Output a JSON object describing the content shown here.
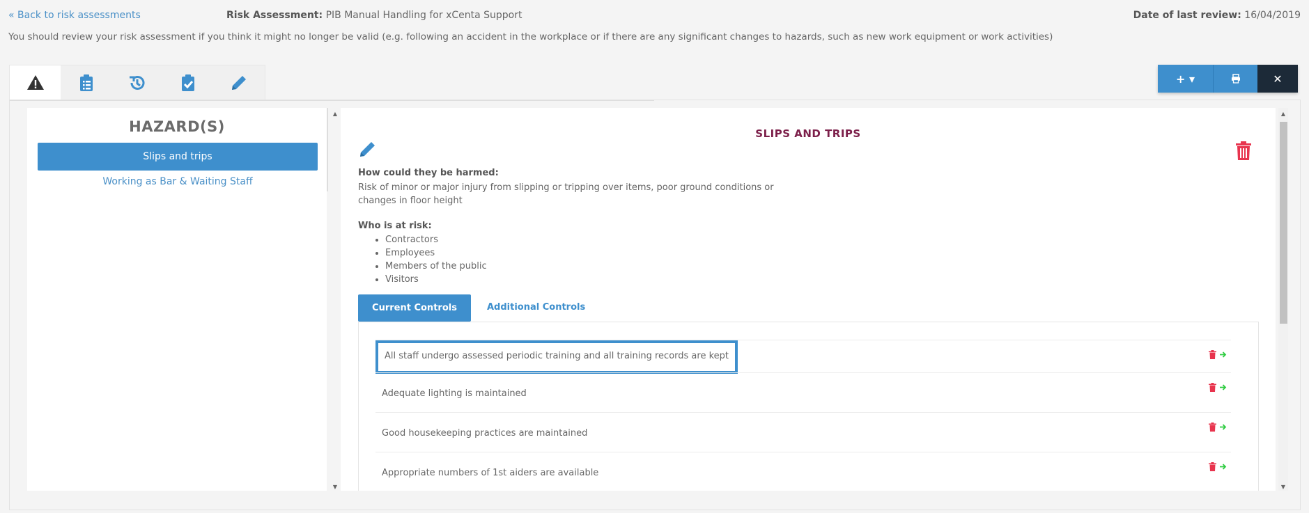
{
  "header": {
    "back_link": "« Back to risk assessments",
    "assessment_label": "Risk Assessment:",
    "assessment_name": "PIB Manual Handling for xCenta Support",
    "review_label": "Date of last review:",
    "review_date": "16/04/2019",
    "notice": "You should review your risk assessment if you think it might no longer be valid (e.g. following an accident in the workplace or if there are any significant changes to hazards, such as new work equipment or work activities)"
  },
  "tabs": [
    {
      "icon": "warning-icon",
      "active": true
    },
    {
      "icon": "clipboard-list-icon",
      "active": false
    },
    {
      "icon": "history-icon",
      "active": false
    },
    {
      "icon": "clipboard-check-icon",
      "active": false
    },
    {
      "icon": "pencil-icon",
      "active": false
    }
  ],
  "actions": {
    "add_label": "+ ▾",
    "print_icon": "print-icon",
    "close_label": "✕"
  },
  "hazards": {
    "title": "HAZARD(S)",
    "items": [
      {
        "label": "Slips and trips",
        "active": true
      },
      {
        "label": "Working as Bar & Waiting Staff",
        "active": false
      }
    ]
  },
  "detail": {
    "title": "SLIPS AND TRIPS",
    "harm_label": "How could they be harmed:",
    "harm_text": "Risk of minor or major injury from slipping or tripping over items, poor ground conditions or changes in floor height",
    "risk_label": "Who is at risk:",
    "at_risk": [
      "Contractors",
      "Employees",
      "Members of the public",
      "Visitors"
    ],
    "control_tabs": {
      "current": "Current Controls",
      "additional": "Additional Controls"
    },
    "controls": [
      "All staff undergo assessed periodic training and all training records are kept",
      "Adequate lighting is maintained",
      "Good housekeeping practices are maintained",
      "Appropriate numbers of 1st aiders are available"
    ]
  },
  "colors": {
    "accent": "#3e8fcd",
    "title": "#7c1f4a",
    "danger": "#e8344e",
    "success": "#2ecc40",
    "dark": "#1c2a38"
  }
}
